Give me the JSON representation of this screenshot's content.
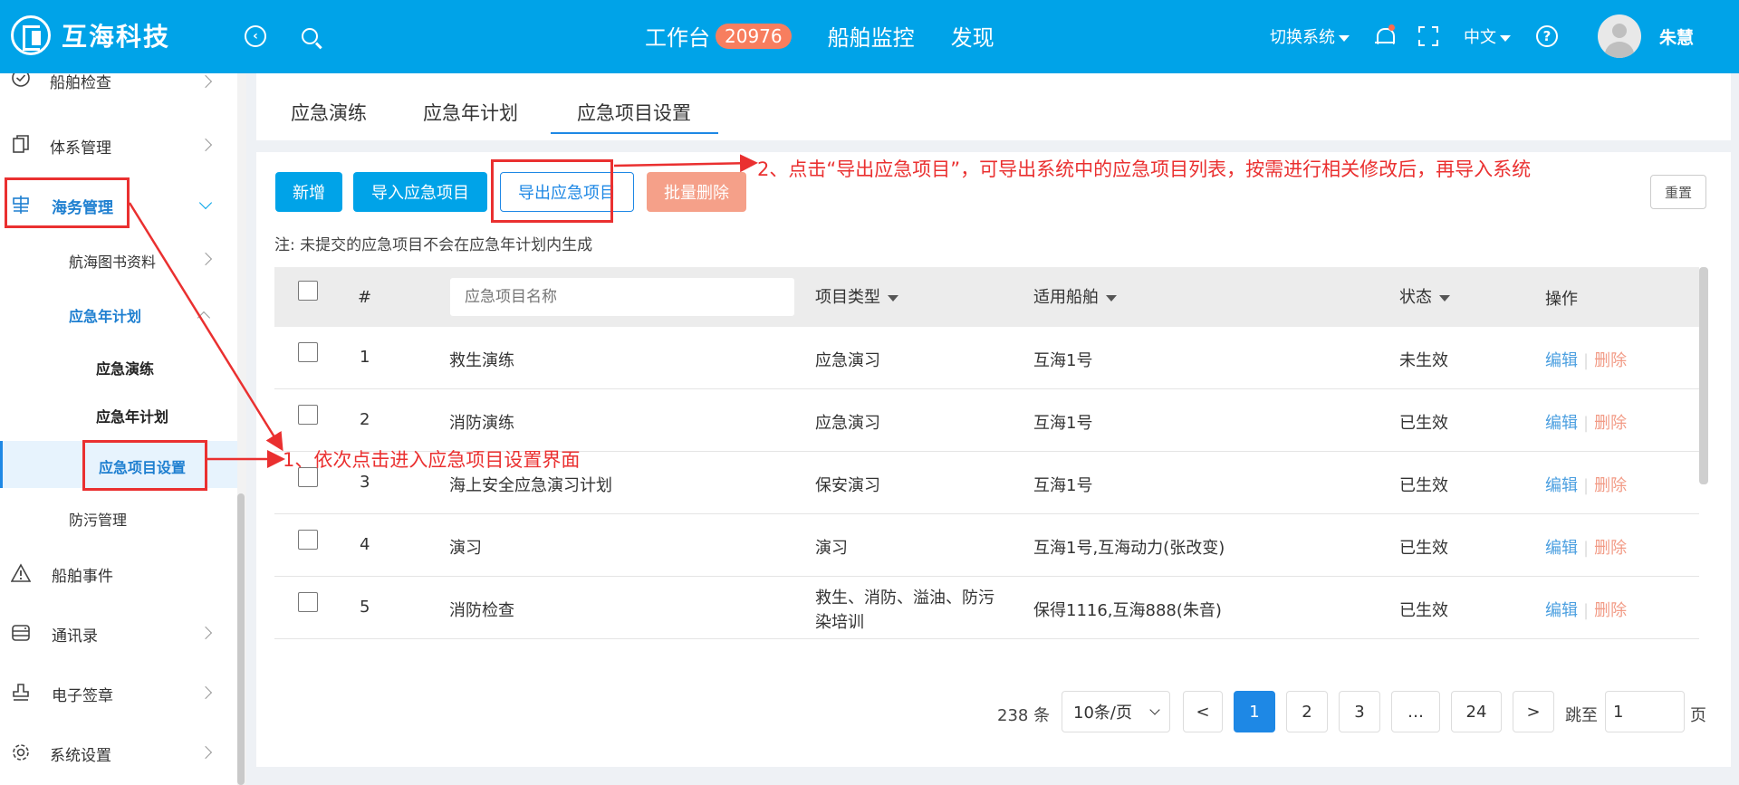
{
  "header": {
    "logo_text": "互海科技",
    "nav": [
      {
        "label": "工作台",
        "badge": "20976"
      },
      {
        "label": "船舶监控"
      },
      {
        "label": "发现"
      }
    ],
    "switch_system": "切换系统",
    "language": "中文",
    "username": "朱慧"
  },
  "sidebar": {
    "items": {
      "ship_inspection": "船舶检查",
      "system_mgmt": "体系管理",
      "maritime_mgmt": "海务管理",
      "nautical_books": "航海图书资料",
      "emergency_annual_plan": "应急年计划",
      "emergency_drill": "应急演练",
      "emergency_annual_plan_sub": "应急年计划",
      "emergency_item_settings": "应急项目设置",
      "pollution_mgmt": "防污管理",
      "ship_events": "船舶事件",
      "contacts": "通讯录",
      "e_seal": "电子签章",
      "system_settings": "系统设置"
    }
  },
  "tabs": [
    "应急演练",
    "应急年计划",
    "应急项目设置"
  ],
  "toolbar": {
    "add": "新增",
    "import": "导入应急项目",
    "export": "导出应急项目",
    "batch_delete": "批量删除",
    "reset": "重置"
  },
  "note": "注: 未提交的应急项目不会在应急年计划内生成",
  "table": {
    "headers": {
      "index": "#",
      "name_placeholder": "应急项目名称",
      "type": "项目类型",
      "ships": "适用船舶",
      "status": "状态",
      "actions": "操作"
    },
    "rows": [
      {
        "no": "1",
        "name": "救生演练",
        "type": "应急演习",
        "ships": "互海1号",
        "status": "未生效"
      },
      {
        "no": "2",
        "name": "消防演练",
        "type": "应急演习",
        "ships": "互海1号",
        "status": "已生效"
      },
      {
        "no": "3",
        "name": "海上安全应急演习计划",
        "type": "保安演习",
        "ships": "互海1号",
        "status": "已生效"
      },
      {
        "no": "4",
        "name": "演习",
        "type": "演习",
        "ships": "互海1号,互海动力(张改变)",
        "status": "已生效"
      },
      {
        "no": "5",
        "name": "消防检查",
        "type_line1": "救生、消防、溢油、防污",
        "type_line2": "染培训",
        "ships": "保得1116,互海888(朱音)",
        "status": "已生效"
      }
    ],
    "edit_label": "编辑",
    "delete_label": "删除",
    "separator": "|"
  },
  "pagination": {
    "total": "238",
    "total_unit": "条",
    "page_size": "10条/页",
    "prev": "<",
    "pages": [
      "1",
      "2",
      "3",
      "…",
      "24"
    ],
    "next": ">",
    "goto_label": "跳至",
    "goto_value": "1",
    "page_unit": "页"
  },
  "annotations": {
    "step1": "1、依次点击进入应急项目设置界面",
    "step2": "2、点击“导出应急项目”，可导出系统中的应急项目列表，按需进行相关修改后，再导入系统"
  },
  "colors": {
    "header_bg": "#00a3e8",
    "primary": "#1e88e5",
    "danger_button": "#f5a089",
    "annotation_red": "#ea3030",
    "badge": "#f77e5f"
  }
}
